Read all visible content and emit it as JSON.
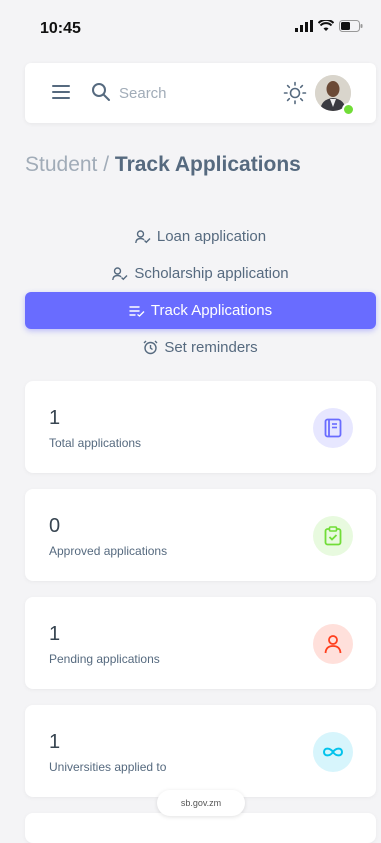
{
  "status_bar": {
    "time": "10:45"
  },
  "navbar": {
    "search_placeholder": "Search"
  },
  "breadcrumb": {
    "parent": "Student / ",
    "current": "Track Applications"
  },
  "menu": {
    "items": [
      {
        "label": "Loan application",
        "icon": "user-check-icon",
        "active": false
      },
      {
        "label": "Scholarship application",
        "icon": "user-check-icon",
        "active": false
      },
      {
        "label": "Track Applications",
        "icon": "list-check-icon",
        "active": true
      },
      {
        "label": "Set reminders",
        "icon": "alarm-icon",
        "active": false
      }
    ]
  },
  "stats": [
    {
      "value": "1",
      "label": "Total applications",
      "icon": "book-icon",
      "color": "#696cff",
      "bg": "#e7e7ff"
    },
    {
      "value": "0",
      "label": "Approved applications",
      "icon": "clipboard-check-icon",
      "color": "#71dd37",
      "bg": "#e8fadf"
    },
    {
      "value": "1",
      "label": "Pending applications",
      "icon": "user-icon",
      "color": "#ff3e1d",
      "bg": "#ffe0db"
    },
    {
      "value": "1",
      "label": "Universities applied to",
      "icon": "infinity-icon",
      "color": "#03c3ec",
      "bg": "#d7f5fc"
    }
  ],
  "browser": {
    "url": "sb.gov.zm"
  },
  "colors": {
    "primary": "#696cff",
    "success": "#71dd37",
    "danger": "#ff3e1d",
    "info": "#03c3ec"
  }
}
